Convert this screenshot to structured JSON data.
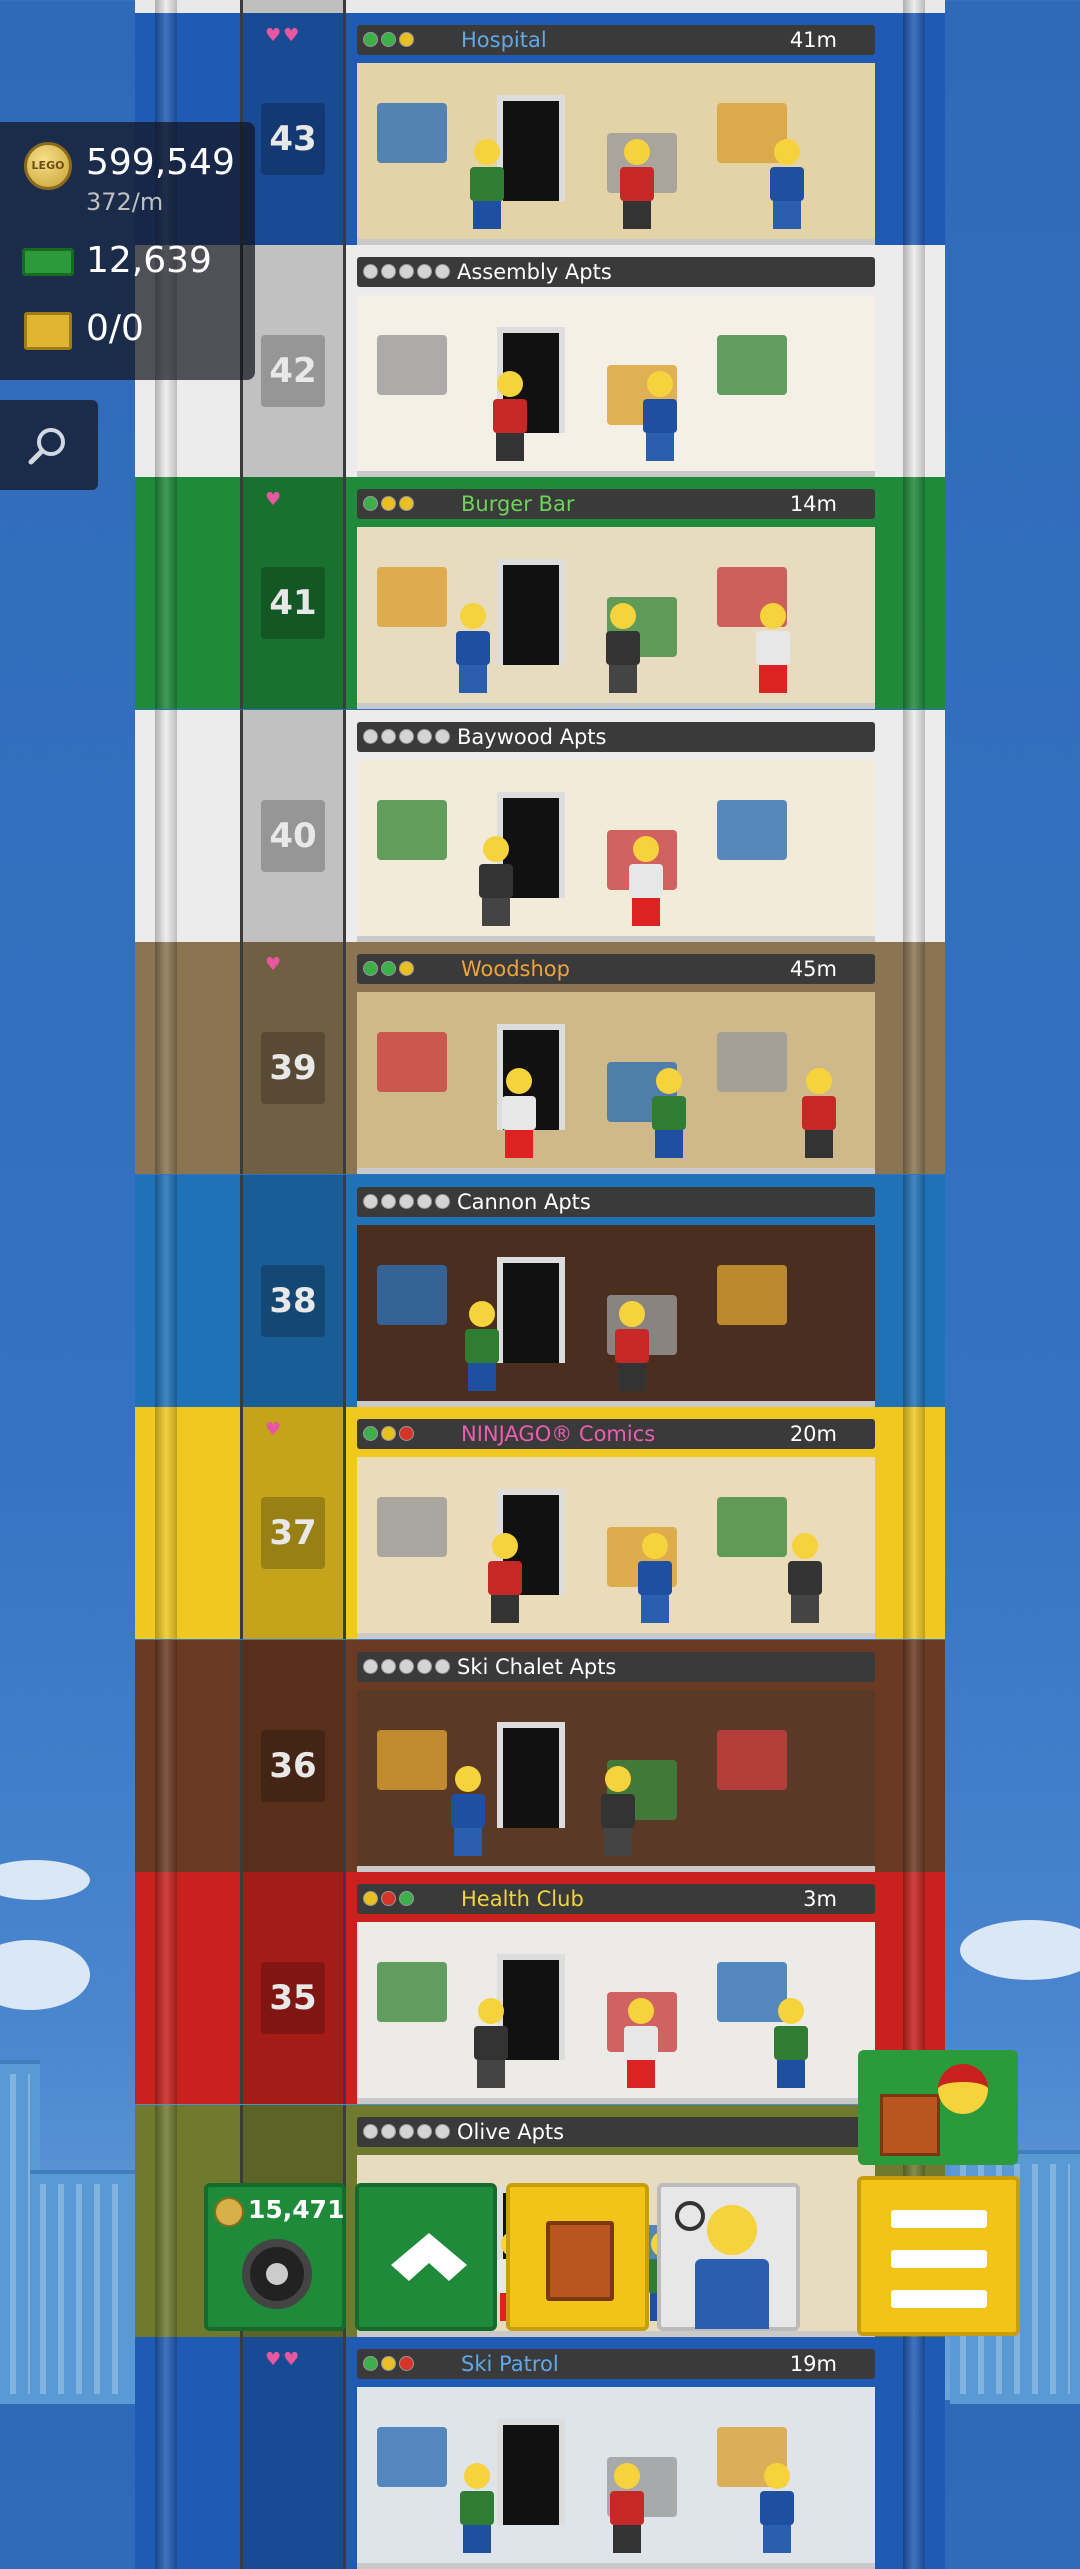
{
  "hud": {
    "coins": "599,549",
    "coin_rate": "372/m",
    "bux": "12,639",
    "crates": "0/0",
    "coin_icon_text": "LEGO"
  },
  "floors": [
    {
      "number": "",
      "name": "",
      "type": "top",
      "color": "#e9e9e9"
    },
    {
      "number": "43",
      "name": "Hospital",
      "type": "business",
      "time": "41m",
      "hearts": "♥♥",
      "color": "#1f5bb5",
      "name_color": "#5fa8ea",
      "dots": [
        "#3cae4a",
        "#3cae4a",
        "#e8c023"
      ]
    },
    {
      "number": "42",
      "name": "Assembly Apts",
      "type": "apt",
      "color": "#ececec"
    },
    {
      "number": "41",
      "name": "Burger Bar",
      "type": "business",
      "time": "14m",
      "hearts": "♥",
      "color": "#1f8a3a",
      "name_color": "#6dd35a",
      "dots": [
        "#3cae4a",
        "#e8c023",
        "#e8c023"
      ]
    },
    {
      "number": "40",
      "name": "Baywood Apts",
      "type": "apt",
      "color": "#ececec"
    },
    {
      "number": "39",
      "name": "Woodshop",
      "type": "business",
      "time": "45m",
      "hearts": "♥",
      "color": "#8a7452",
      "name_color": "#f2a23a",
      "dots": [
        "#3cae4a",
        "#3cae4a",
        "#e8c023"
      ]
    },
    {
      "number": "38",
      "name": "Cannon Apts",
      "type": "apt",
      "color": "#1f72b8"
    },
    {
      "number": "37",
      "name": "NINJAGO® Comics",
      "type": "business",
      "time": "20m",
      "hearts": "♥",
      "color": "#f0c820",
      "name_color": "#e85fb0",
      "dots": [
        "#3cae4a",
        "#e8c023",
        "#d6342a"
      ]
    },
    {
      "number": "36",
      "name": "Ski Chalet Apts",
      "type": "apt",
      "color": "#6b3a22"
    },
    {
      "number": "35",
      "name": "Health Club",
      "type": "business",
      "time": "3m",
      "hearts": "",
      "color": "#c8211e",
      "name_color": "#f2d43a",
      "dots": [
        "#e8c023",
        "#d6342a",
        "#3cae4a"
      ]
    },
    {
      "number": "",
      "name": "Olive Apts",
      "type": "apt",
      "color": "#6f7a2e"
    },
    {
      "number": "",
      "name": "Ski Patrol",
      "type": "business",
      "time": "19m",
      "hearts": "♥♥",
      "color": "#1f5bb5",
      "name_color": "#5fa8ea",
      "dots": [
        "#3cae4a",
        "#e8c023",
        "#d6342a"
      ]
    }
  ],
  "bottom_bar": {
    "vehicle_cost": "15,471"
  },
  "colors": {
    "sky": "#3473c2",
    "button_green": "#1e8a3a",
    "button_yellow": "#f2c418"
  }
}
